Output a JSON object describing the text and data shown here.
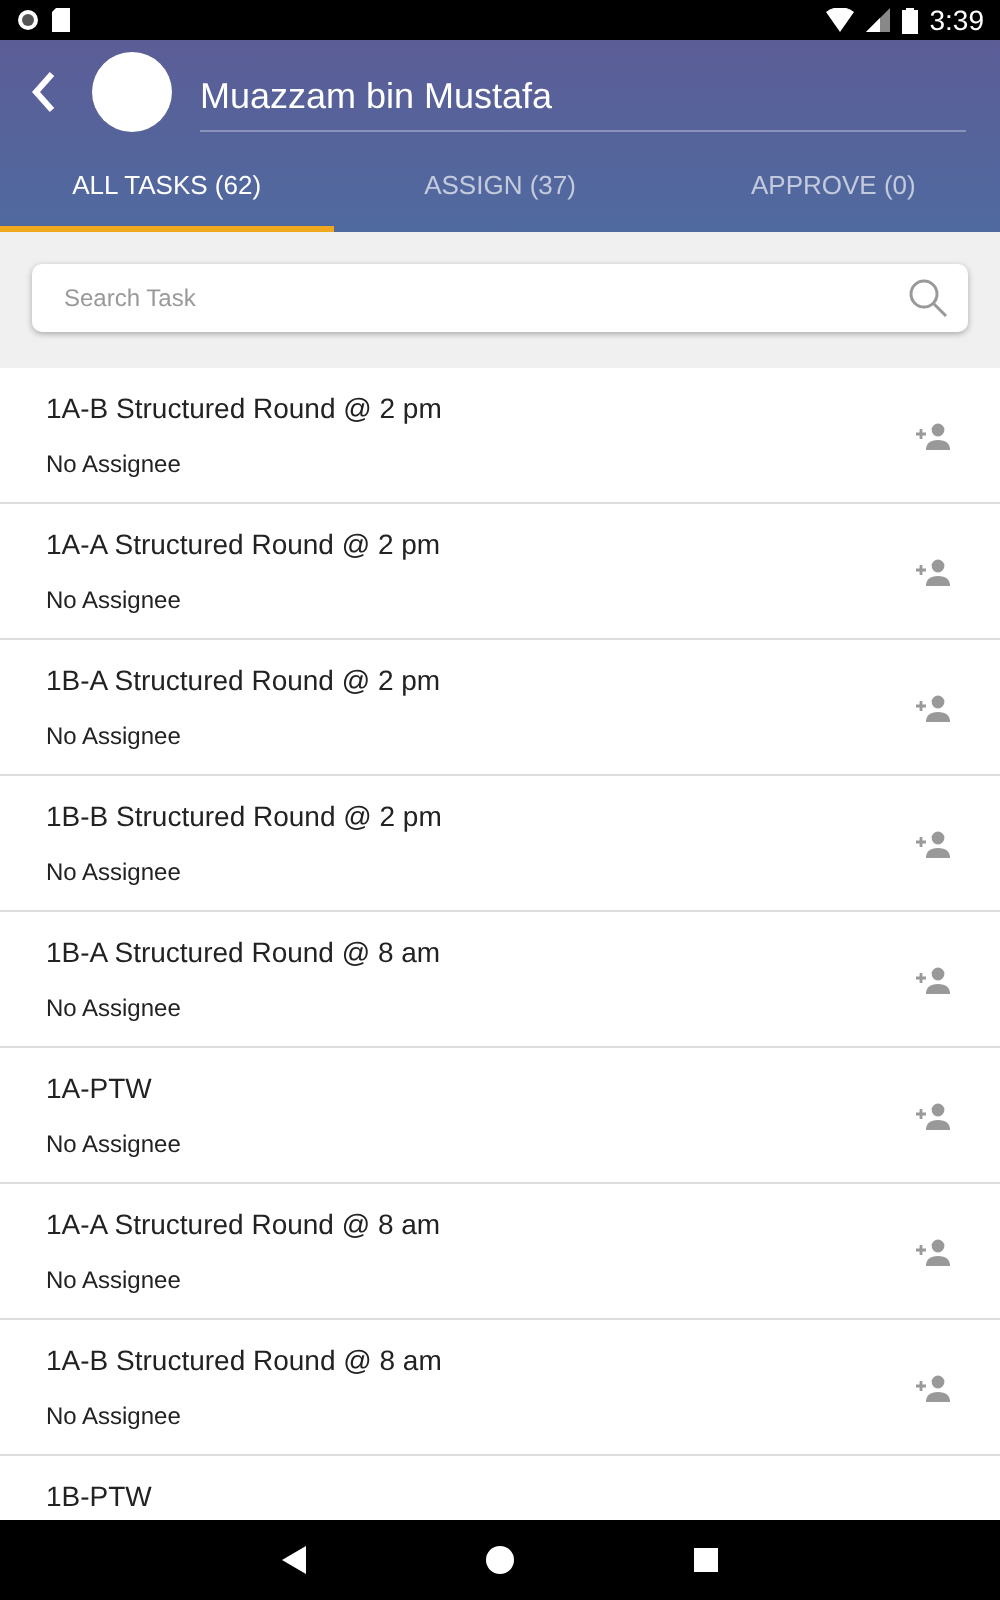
{
  "status_bar": {
    "time": "3:39"
  },
  "header": {
    "title": "Muazzam bin Mustafa"
  },
  "tabs": [
    {
      "label": "ALL TASKS (62)",
      "selected": true
    },
    {
      "label": "ASSIGN (37)",
      "selected": false
    },
    {
      "label": "APPROVE (0)",
      "selected": false
    }
  ],
  "search": {
    "placeholder": "Search Task"
  },
  "tasks": [
    {
      "title": "1A-B Structured Round @ 2 pm",
      "assignee": "No Assignee"
    },
    {
      "title": "1A-A Structured Round @ 2 pm",
      "assignee": "No Assignee"
    },
    {
      "title": "1B-A Structured Round @ 2 pm",
      "assignee": "No Assignee"
    },
    {
      "title": "1B-B Structured Round @ 2 pm",
      "assignee": "No Assignee"
    },
    {
      "title": "1B-A Structured Round @ 8 am",
      "assignee": "No Assignee"
    },
    {
      "title": "1A-PTW",
      "assignee": "No Assignee"
    },
    {
      "title": "1A-A Structured Round @ 8 am",
      "assignee": "No Assignee"
    },
    {
      "title": "1A-B Structured Round @ 8 am",
      "assignee": "No Assignee"
    },
    {
      "title": "1B-PTW"
    }
  ]
}
